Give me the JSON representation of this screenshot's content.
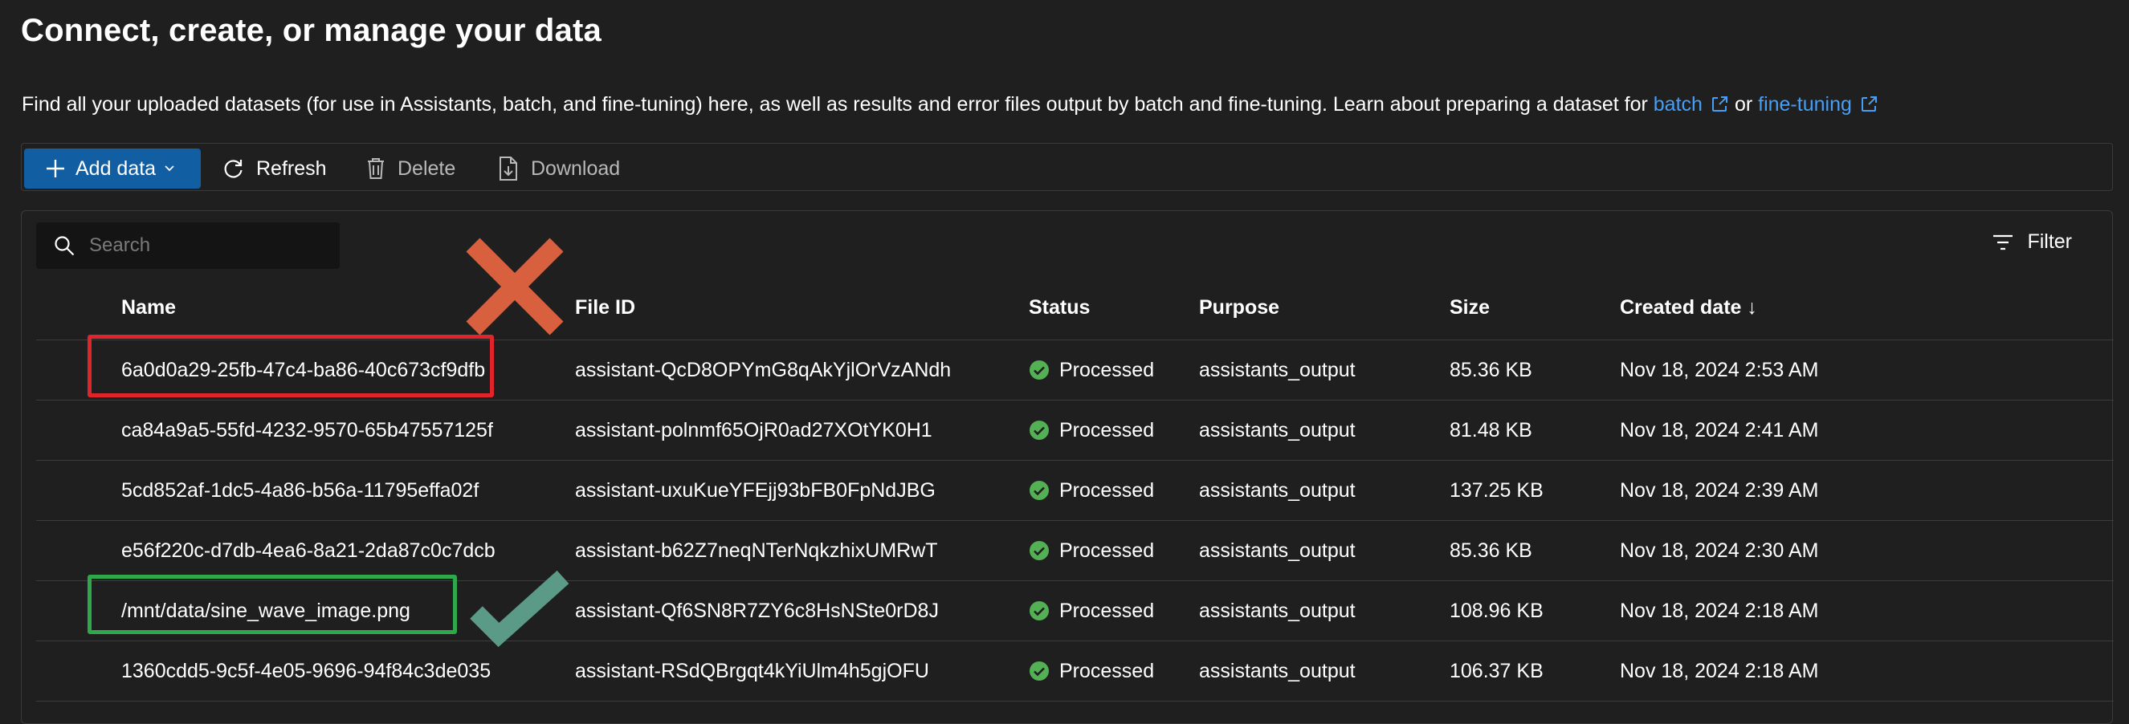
{
  "page": {
    "title": "Connect, create, or manage your data",
    "description": "Find all your uploaded datasets (for use in Assistants, batch, and fine-tuning) here, as well as results and error files output by batch and fine-tuning. Learn about preparing a dataset for ",
    "link_batch": "batch",
    "link_or": "or",
    "link_finetuning": "fine-tuning"
  },
  "toolbar": {
    "add_data": "Add data",
    "refresh": "Refresh",
    "delete": "Delete",
    "download": "Download"
  },
  "search": {
    "placeholder": "Search"
  },
  "filter_label": "Filter",
  "table": {
    "headers": {
      "name": "Name",
      "file_id": "File ID",
      "status": "Status",
      "purpose": "Purpose",
      "size": "Size",
      "created": "Created date ↓"
    },
    "rows": [
      {
        "name": "6a0d0a29-25fb-47c4-ba86-40c673cf9dfb",
        "file_id": "assistant-QcD8OPYmG8qAkYjlOrVzANdh",
        "status": "Processed",
        "purpose": "assistants_output",
        "size": "85.36 KB",
        "created": "Nov 18, 2024 2:53 AM"
      },
      {
        "name": "ca84a9a5-55fd-4232-9570-65b47557125f",
        "file_id": "assistant-polnmf65OjR0ad27XOtYK0H1",
        "status": "Processed",
        "purpose": "assistants_output",
        "size": "81.48 KB",
        "created": "Nov 18, 2024 2:41 AM"
      },
      {
        "name": "5cd852af-1dc5-4a86-b56a-11795effa02f",
        "file_id": "assistant-uxuKueYFEjj93bFB0FpNdJBG",
        "status": "Processed",
        "purpose": "assistants_output",
        "size": "137.25 KB",
        "created": "Nov 18, 2024 2:39 AM"
      },
      {
        "name": "e56f220c-d7db-4ea6-8a21-2da87c0c7dcb",
        "file_id": "assistant-b62Z7neqNTerNqkzhixUMRwT",
        "status": "Processed",
        "purpose": "assistants_output",
        "size": "85.36 KB",
        "created": "Nov 18, 2024 2:30 AM"
      },
      {
        "name": "/mnt/data/sine_wave_image.png",
        "file_id": "assistant-Qf6SN8R7ZY6c8HsNSte0rD8J",
        "status": "Processed",
        "purpose": "assistants_output",
        "size": "108.96 KB",
        "created": "Nov 18, 2024 2:18 AM"
      },
      {
        "name": "1360cdd5-9c5f-4e05-9696-94f84c3de035",
        "file_id": "assistant-RSdQBrgqt4kYiUlm4h5gjOFU",
        "status": "Processed",
        "purpose": "assistants_output",
        "size": "106.37 KB",
        "created": "Nov 18, 2024 2:18 AM"
      }
    ]
  },
  "colors": {
    "accent": "#115ea3",
    "link": "#479ef5",
    "status_ok": "#54b054",
    "annotation_bad": "#e0242c",
    "annotation_bad_x": "#d9603f",
    "annotation_good": "#2ea84a",
    "annotation_good_check": "#5a9a86"
  },
  "icons": {
    "add": "plus-icon",
    "refresh": "refresh-icon",
    "delete": "trash-icon",
    "download": "download-icon",
    "search": "search-icon",
    "filter": "filter-icon",
    "status": "checkmark-circle-icon",
    "external": "external-link-icon"
  }
}
